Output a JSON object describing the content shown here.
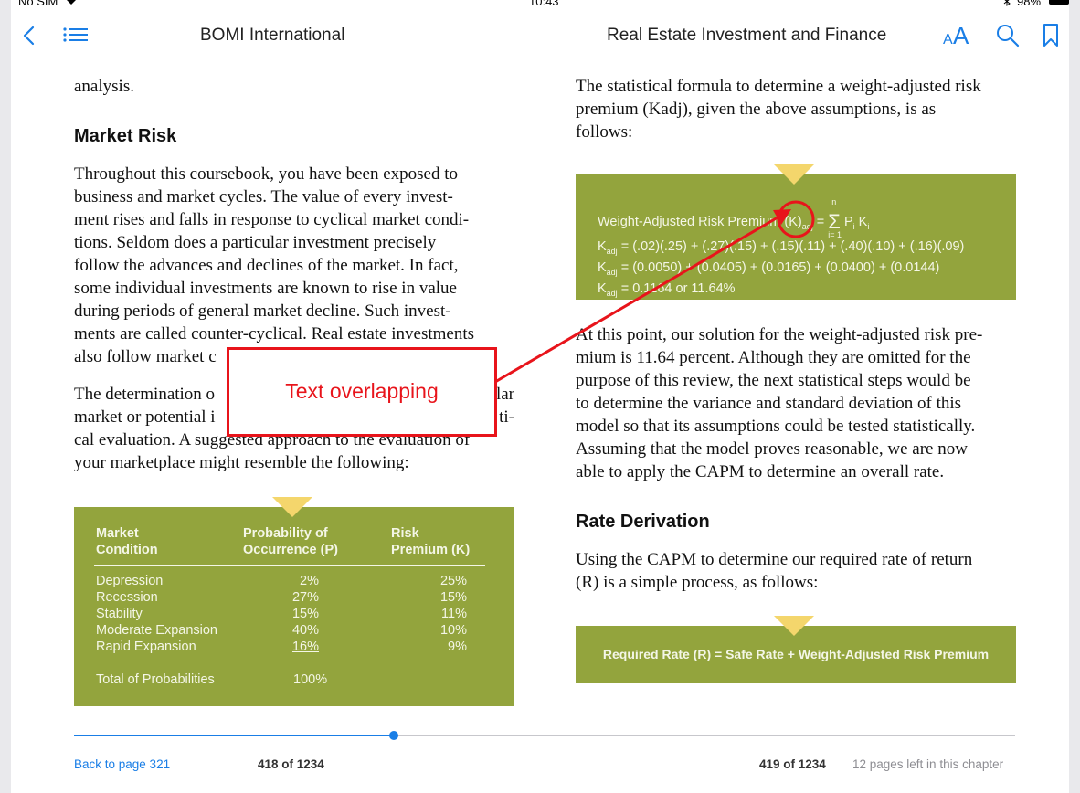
{
  "status": {
    "carrier": "No SIM",
    "time": "10:43",
    "battery": "98%"
  },
  "nav": {
    "left_title": "BOMI International",
    "right_title": "Real Estate Investment and Finance",
    "font_size_label": "AA"
  },
  "left_page": {
    "top_fragment": "analysis.",
    "heading": "Market Risk",
    "para1_lines": [
      "Throughout this coursebook, you have been exposed to",
      "business and market cycles. The value of every invest-",
      "ment rises and falls in response to cyclical market condi-",
      "tions. Seldom does a particular investment precisely",
      "follow the advances and declines of the market. In fact,",
      "some individual investments are known to rise in value",
      "during periods of general market decline. Such invest-",
      "ments are called counter-cyclical. Real estate investments",
      "also follow market c"
    ],
    "para2_lines": [
      "The determination o",
      "market or potential i",
      "cal evaluation. A suggested approach to the evaluation of",
      "your marketplace might resemble the following:"
    ],
    "para2_right_fragments": [
      "lar",
      "ti-"
    ]
  },
  "table": {
    "headers": [
      [
        "Market",
        "Condition"
      ],
      [
        "Probability of",
        "Occurrence (P)"
      ],
      [
        "Risk",
        "Premium (K)"
      ]
    ],
    "rows": [
      {
        "condition": "Depression",
        "probability": "2%",
        "premium": "25%"
      },
      {
        "condition": "Recession",
        "probability": "27%",
        "premium": "15%"
      },
      {
        "condition": "Stability",
        "probability": "15%",
        "premium": "11%"
      },
      {
        "condition": "Moderate Expansion",
        "probability": "40%",
        "premium": "10%"
      },
      {
        "condition": "Rapid Expansion",
        "probability": "16%",
        "premium": "9%"
      }
    ],
    "total_label": "Total of Probabilities",
    "total_value": "100%"
  },
  "annotation": {
    "label": "Text overlapping",
    "color": "#e8141b"
  },
  "right_page": {
    "intro_lines": [
      "The statistical formula to determine a weight-adjusted risk",
      "premium (Kadj), given the above assumptions, is as",
      "follows:"
    ],
    "formula": {
      "label": "Weight-Adjusted Risk Premium (K)",
      "sub_adj": "adj",
      "equals": "=",
      "sigma": "Σ",
      "sigma_top": "n",
      "sigma_bottom": "i= 1",
      "term": "P",
      "term_sub": "i",
      "term2": "K",
      "term2_sub": "i",
      "line1": "K",
      "line1_sub": "adj",
      "line1_rest": " = (.02)(.25) + (.27)(.15) + (.15)(.11) + (.40)(.10) + (.16)(.09)",
      "line2_rest": " = (0.0050) + (0.0405) + (0.0165) + (0.0400) + (0.0144)",
      "line3_rest": " = 0.1164   or 11.64%"
    },
    "para2_lines": [
      "At this point, our solution for the weight-adjusted risk pre-",
      "mium is 11.64 percent. Although they are omitted for the",
      "purpose of this review, the next statistical steps would be",
      "to determine the variance and standard deviation of this",
      "model so that its assumptions could be tested statistically.",
      "Assuming that the model proves reasonable, we are now",
      "able to apply the CAPM to determine an overall rate."
    ],
    "heading": "Rate Derivation",
    "para3_lines": [
      "Using the CAPM to determine our required rate of return",
      "(R) is a simple process, as follows:"
    ],
    "rate_box": "Required Rate (R) = Safe Rate + Weight-Adjusted Risk Premium"
  },
  "footer": {
    "back_link": "Back to page 321",
    "left_page_num": "418 of 1234",
    "right_page_num": "419 of 1234",
    "pages_left": "12 pages left in this chapter",
    "progress": 0.3399
  },
  "colors": {
    "accent": "#1a7ee6",
    "green_box": "#93a43d",
    "triangle": "#f4d66c"
  }
}
